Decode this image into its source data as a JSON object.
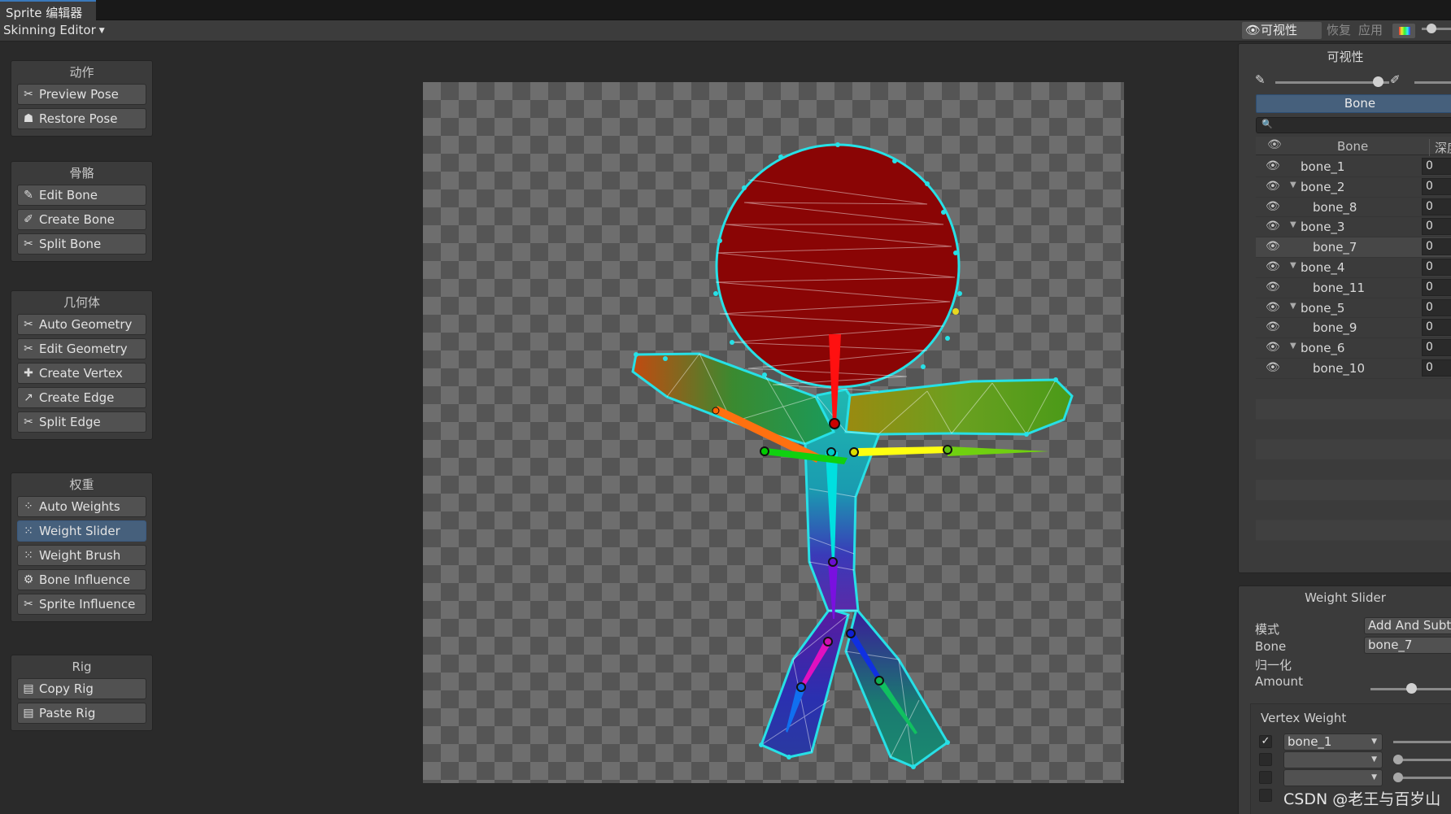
{
  "window": {
    "tab_title": "Sprite 编辑器"
  },
  "toolbar": {
    "mode_dropdown": "Skinning Editor",
    "visibility_label": "可视性",
    "restore_label": "恢复",
    "apply_label": "应用"
  },
  "panels": [
    {
      "title": "动作",
      "buttons": [
        {
          "label": "Preview Pose",
          "icon": "preview-pose-icon"
        },
        {
          "label": "Restore Pose",
          "icon": "restore-pose-icon"
        }
      ]
    },
    {
      "title": "骨骼",
      "buttons": [
        {
          "label": "Edit Bone",
          "icon": "edit-bone-icon"
        },
        {
          "label": "Create Bone",
          "icon": "create-bone-icon"
        },
        {
          "label": "Split Bone",
          "icon": "split-bone-icon"
        }
      ]
    },
    {
      "title": "几何体",
      "buttons": [
        {
          "label": "Auto Geometry",
          "icon": "auto-geometry-icon"
        },
        {
          "label": "Edit Geometry",
          "icon": "edit-geometry-icon"
        },
        {
          "label": "Create Vertex",
          "icon": "create-vertex-icon"
        },
        {
          "label": "Create Edge",
          "icon": "create-edge-icon"
        },
        {
          "label": "Split Edge",
          "icon": "split-edge-icon"
        }
      ]
    },
    {
      "title": "权重",
      "buttons": [
        {
          "label": "Auto Weights",
          "icon": "auto-weights-icon"
        },
        {
          "label": "Weight Slider",
          "icon": "weight-slider-icon",
          "selected": true
        },
        {
          "label": "Weight Brush",
          "icon": "weight-brush-icon"
        },
        {
          "label": "Bone Influence",
          "icon": "bone-influence-icon"
        },
        {
          "label": "Sprite Influence",
          "icon": "sprite-influence-icon"
        }
      ]
    },
    {
      "title": "Rig",
      "buttons": [
        {
          "label": "Copy Rig",
          "icon": "copy-rig-icon"
        },
        {
          "label": "Paste Rig",
          "icon": "paste-rig-icon"
        }
      ]
    }
  ],
  "visibility_panel": {
    "title": "可视性",
    "opacity_level": 0.9,
    "tab_label": "Bone",
    "search_placeholder": "",
    "columns": {
      "bone": "Bone",
      "depth": "深度"
    },
    "bones": [
      {
        "name": "bone_1",
        "depth": "0",
        "level": 0,
        "expanded": null
      },
      {
        "name": "bone_2",
        "depth": "0",
        "level": 0,
        "expanded": true
      },
      {
        "name": "bone_8",
        "depth": "0",
        "level": 1,
        "expanded": null
      },
      {
        "name": "bone_3",
        "depth": "0",
        "level": 0,
        "expanded": true
      },
      {
        "name": "bone_7",
        "depth": "0",
        "level": 1,
        "expanded": null,
        "selected": true
      },
      {
        "name": "bone_4",
        "depth": "0",
        "level": 0,
        "expanded": true
      },
      {
        "name": "bone_11",
        "depth": "0",
        "level": 1,
        "expanded": null
      },
      {
        "name": "bone_5",
        "depth": "0",
        "level": 0,
        "expanded": true
      },
      {
        "name": "bone_9",
        "depth": "0",
        "level": 1,
        "expanded": null
      },
      {
        "name": "bone_6",
        "depth": "0",
        "level": 0,
        "expanded": true
      },
      {
        "name": "bone_10",
        "depth": "0",
        "level": 1,
        "expanded": null
      }
    ]
  },
  "weight_slider": {
    "title": "Weight Slider",
    "mode_label": "模式",
    "mode_value": "Add And Subtract",
    "bone_label": "Bone",
    "bone_value": "bone_7",
    "normalize_label": "归一化",
    "amount_label": "Amount",
    "amount_level": 0.45,
    "vertex_weight_title": "Vertex Weight",
    "vertex_weights": [
      {
        "checked": true,
        "bone": "bone_1"
      },
      {
        "checked": false,
        "bone": ""
      },
      {
        "checked": false,
        "bone": ""
      },
      {
        "checked": false,
        "bone": ""
      }
    ]
  },
  "watermark": "CSDN @老王与百岁山",
  "colors": {
    "accent": "#46607c",
    "outline": "#27e0e6",
    "head": "#8a0505"
  }
}
